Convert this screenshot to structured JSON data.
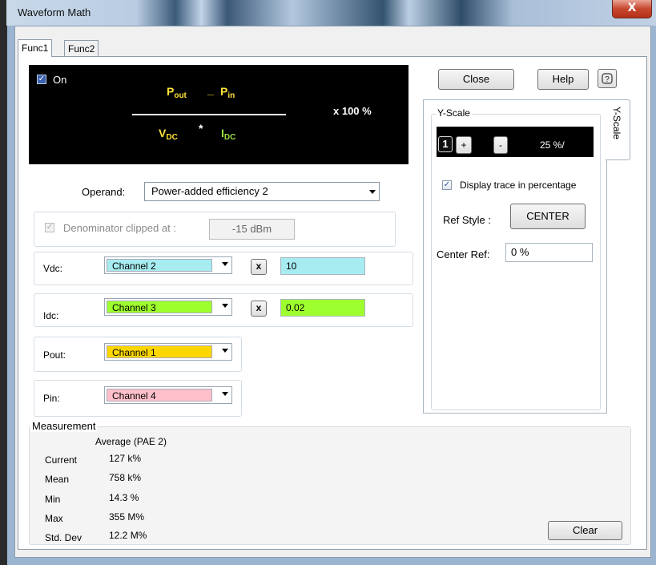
{
  "window": {
    "title": "Waveform Math",
    "close_glyph": "X"
  },
  "tabs": [
    {
      "label": "Func1"
    },
    {
      "label": "Func2"
    }
  ],
  "formula": {
    "on_label": "On",
    "on_checked": true,
    "pout": "P",
    "pout_sub": "out",
    "minus": "_",
    "pin": "P",
    "pin_sub": "in",
    "vdc": "V",
    "vdc_sub": "DC",
    "times": "*",
    "idc": "I",
    "idc_sub": "DC",
    "multiplier": "x 100 %"
  },
  "operand": {
    "label": "Operand:",
    "value": "Power-added efficiency 2"
  },
  "denominator": {
    "label": "Denominator clipped at :",
    "value": "-15 dBm",
    "checked": true
  },
  "vdc": {
    "label": "Vdc:",
    "channel": "Channel 2",
    "x_label": "x",
    "value": "10",
    "color": "#a7ecf0"
  },
  "idc": {
    "label": "Idc:",
    "channel": "Channel 3",
    "x_label": "x",
    "value": "0.02",
    "color": "#9eff2e"
  },
  "pout": {
    "label": "Pout:",
    "channel": "Channel 1",
    "color": "#ffd700"
  },
  "pin": {
    "label": "Pin:",
    "channel": "Channel 4",
    "color": "#ffc0cb"
  },
  "buttons": {
    "close": "Close",
    "help": "Help",
    "help_icon": "?-icon",
    "clear": "Clear"
  },
  "yscale": {
    "group_label": "Y-Scale",
    "side_tab": "Y-Scale",
    "channel_num": "1",
    "plus": "+",
    "minus": "-",
    "scale_value": "25 %/",
    "display_pct_label": "Display trace in percentage",
    "display_pct_checked": true,
    "ref_style_label": "Ref Style :",
    "ref_style_value": "CENTER",
    "center_ref_label": "Center Ref:",
    "center_ref_value": "0  %"
  },
  "measurement": {
    "title": "Measurement",
    "column_header": "Average (PAE 2)",
    "rows": [
      {
        "label": "Current",
        "value": "127 k%"
      },
      {
        "label": "Mean",
        "value": "758 k%"
      },
      {
        "label": "Min",
        "value": "14.3 %"
      },
      {
        "label": "Max",
        "value": "355 M%"
      },
      {
        "label": "Std. Dev",
        "value": "12.2 M%"
      }
    ]
  }
}
